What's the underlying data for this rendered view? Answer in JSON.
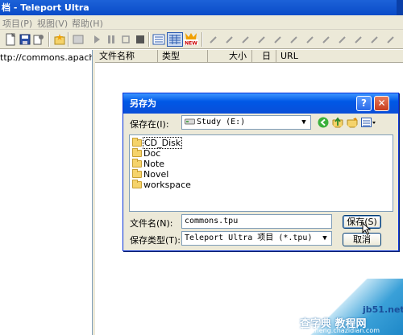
{
  "window": {
    "title": "档 - Teleport Ultra"
  },
  "menubar": {
    "items": [
      "项目(P)",
      "视图(V)",
      "帮助(H)"
    ]
  },
  "left_pane": {
    "url": "ttp://commons.apache.org/"
  },
  "list_columns": [
    "文件名称",
    "类型",
    "大小",
    "日期",
    "URL"
  ],
  "dialog": {
    "title": "另存为",
    "save_in_label": "保存在(I):",
    "save_in_value": "Study (E:)",
    "folders": [
      "CD_Disk",
      "Doc",
      "Note",
      "Novel",
      "workspace"
    ],
    "filename_label": "文件名(N):",
    "filename_value": "commons.tpu",
    "filetype_label": "保存类型(T):",
    "filetype_value": "Teleport Ultra 项目 (*.tpu)",
    "save_button": "保存(S)",
    "cancel_button": "取消",
    "help_glyph": "?",
    "close_glyph": "✕"
  },
  "watermark": {
    "site": "jb51.net",
    "text": "查字典 教程网",
    "url": "jiaocheng.chazidian.com"
  },
  "colors": {
    "title_bar": "#0a4bc8",
    "dialog_title": "#0058e6",
    "dialog_bg": "#ece9d8",
    "close_button": "#c73d1e"
  }
}
